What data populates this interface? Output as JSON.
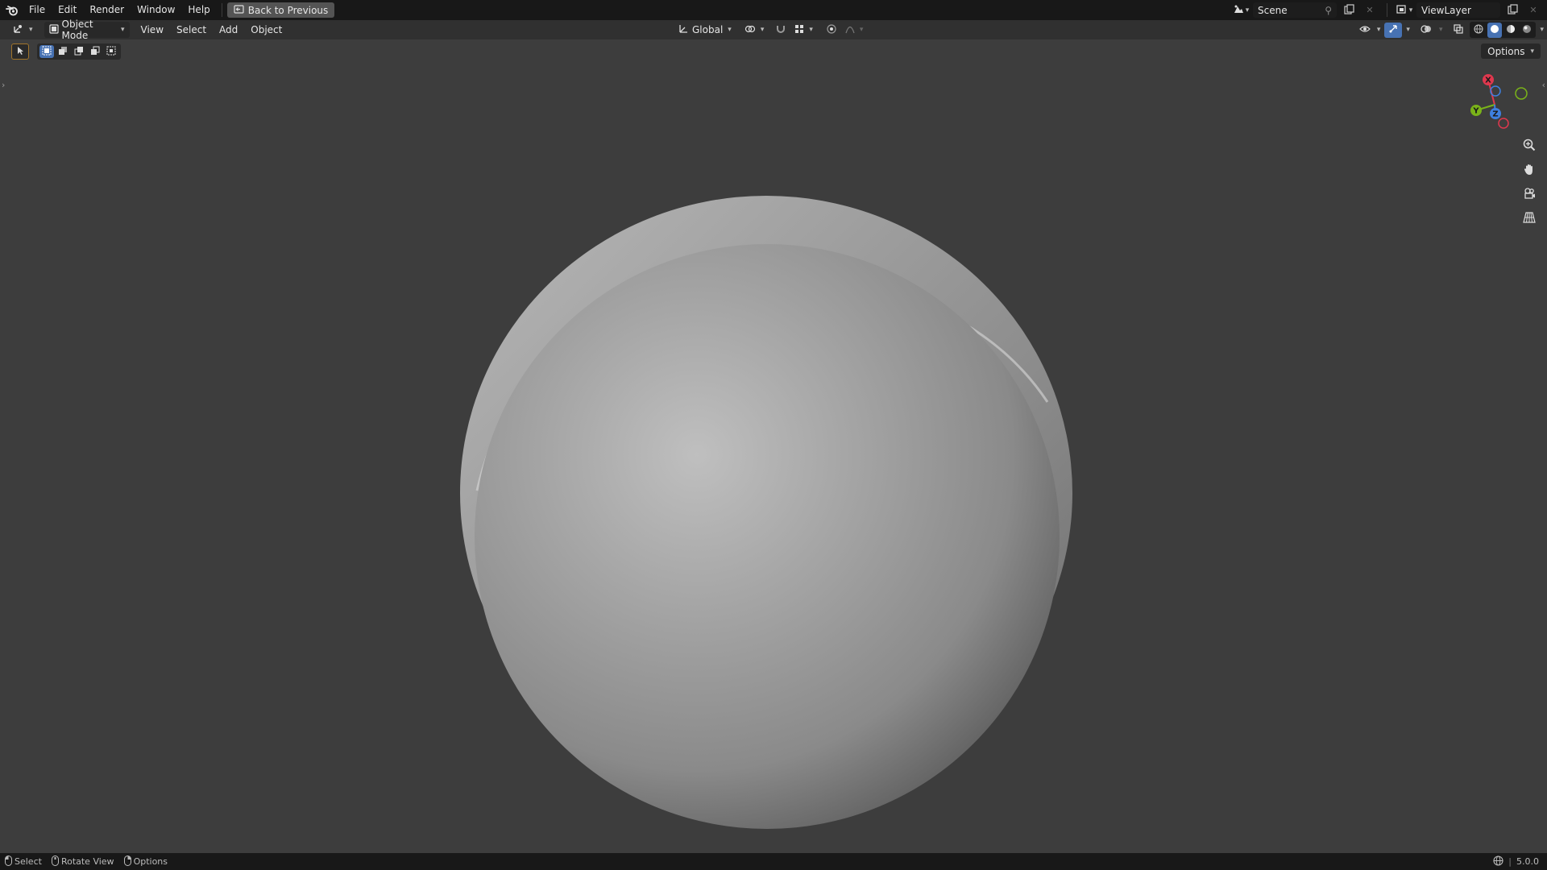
{
  "topbar": {
    "menus": [
      "File",
      "Edit",
      "Render",
      "Window",
      "Help"
    ],
    "back_button": "Back to Previous",
    "scene": "Scene",
    "view_layer": "ViewLayer"
  },
  "header": {
    "mode": "Object Mode",
    "menus": [
      "View",
      "Select",
      "Add",
      "Object"
    ],
    "transform_orientation": "Global",
    "options": "Options"
  },
  "gizmo": {
    "x": "X",
    "y": "Y",
    "z": "Z"
  },
  "statusbar": {
    "select": "Select",
    "rotate_view": "Rotate View",
    "options": "Options",
    "version": "5.0.0"
  },
  "colors": {
    "topbar_bg": "#181818",
    "header_bg": "#303030",
    "viewport_bg": "#3d3d3d",
    "axis_x": "#e0384e",
    "axis_y": "#7ab319",
    "axis_z": "#3e80e0",
    "accent": "#4772b3"
  }
}
